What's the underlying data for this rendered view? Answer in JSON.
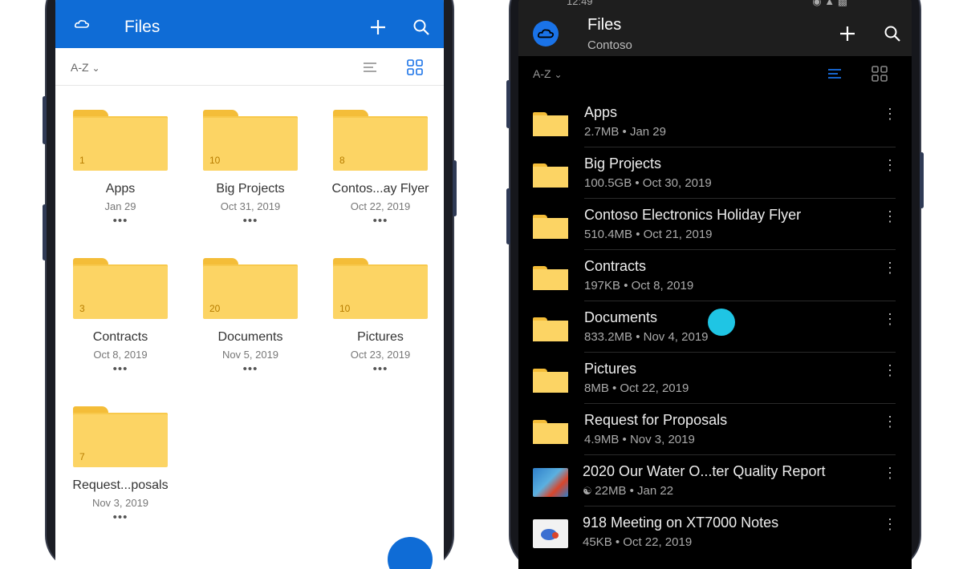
{
  "left_app": {
    "title": "Files",
    "sort_label": "A-Z",
    "folders": [
      {
        "name": "Apps",
        "date": "Jan 29",
        "count": "1"
      },
      {
        "name": "Big Projects",
        "date": "Oct 31, 2019",
        "count": "10"
      },
      {
        "name": "Contos...ay Flyer",
        "date": "Oct 22, 2019",
        "count": "8"
      },
      {
        "name": "Contracts",
        "date": "Oct 8, 2019",
        "count": "3"
      },
      {
        "name": "Documents",
        "date": "Nov 5, 2019",
        "count": "20"
      },
      {
        "name": "Pictures",
        "date": "Oct 23, 2019",
        "count": "10"
      },
      {
        "name": "Request...posals",
        "date": "Nov 3, 2019",
        "count": "7"
      }
    ],
    "more_label": "•••",
    "accent": "#0f6cd6"
  },
  "right_app": {
    "title": "Files",
    "subtitle": "Contoso",
    "sort_label": "A-Z",
    "status_time": "12:49",
    "rows": [
      {
        "name": "Apps",
        "meta": "2.7MB • Jan 29",
        "icon": "folder-icon"
      },
      {
        "name": "Big Projects",
        "meta": "100.5GB • Oct 30, 2019",
        "icon": "folder-icon"
      },
      {
        "name": "Contoso Electronics Holiday Flyer",
        "meta": "510.4MB • Oct 21, 2019",
        "icon": "folder-icon"
      },
      {
        "name": "Contracts",
        "meta": "197KB • Oct 8, 2019",
        "icon": "folder-icon"
      },
      {
        "name": "Documents",
        "meta": "833.2MB • Nov 4, 2019",
        "icon": "folder-icon"
      },
      {
        "name": "Pictures",
        "meta": "8MB • Oct 22, 2019",
        "icon": "folder-icon"
      },
      {
        "name": "Request for Proposals",
        "meta": "4.9MB • Nov 3, 2019",
        "icon": "folder-icon"
      },
      {
        "name": "2020 Our Water O...ter Quality Report",
        "meta": "22MB • Jan 22",
        "icon": "document-thumbnail"
      },
      {
        "name": "918 Meeting on XT7000 Notes",
        "meta": "45KB • Oct 22, 2019",
        "icon": "document-thumbnail"
      }
    ],
    "more_label": "⋮",
    "accent": "#1a73e8"
  }
}
